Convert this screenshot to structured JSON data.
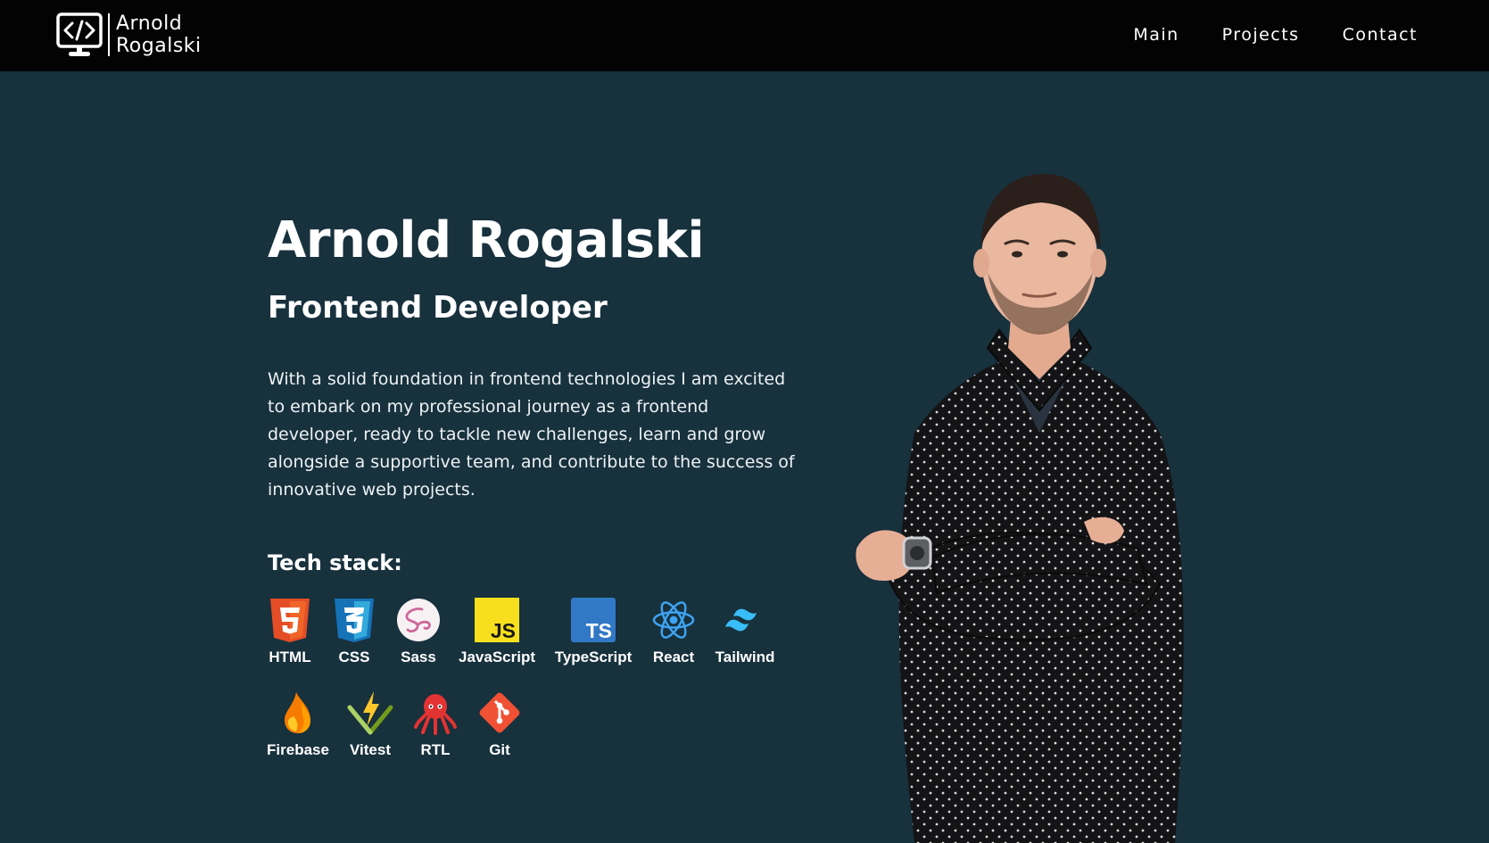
{
  "header": {
    "logo_line1": "Arnold",
    "logo_line2": "Rogalski",
    "nav": [
      "Main",
      "Projects",
      "Contact"
    ]
  },
  "hero": {
    "name": "Arnold Rogalski",
    "role": "Frontend Developer",
    "bio": "With a solid foundation in frontend technologies I am excited to embark on my professional journey as a frontend developer, ready to tackle new challenges, learn and grow alongside a supportive team, and contribute to the success of innovative web projects.",
    "stack_title": "Tech stack:",
    "stack": [
      {
        "label": "HTML",
        "icon": "html5-icon"
      },
      {
        "label": "CSS",
        "icon": "css3-icon"
      },
      {
        "label": "Sass",
        "icon": "sass-icon"
      },
      {
        "label": "JavaScript",
        "icon": "javascript-icon"
      },
      {
        "label": "TypeScript",
        "icon": "typescript-icon"
      },
      {
        "label": "React",
        "icon": "react-icon"
      },
      {
        "label": "Tailwind",
        "icon": "tailwind-icon"
      },
      {
        "label": "Firebase",
        "icon": "firebase-icon"
      },
      {
        "label": "Vitest",
        "icon": "vitest-icon"
      },
      {
        "label": "RTL",
        "icon": "octopus-icon"
      },
      {
        "label": "Git",
        "icon": "git-icon"
      }
    ]
  },
  "colors": {
    "background": "#17313d",
    "topbar": "#030303",
    "text": "#ffffff"
  }
}
